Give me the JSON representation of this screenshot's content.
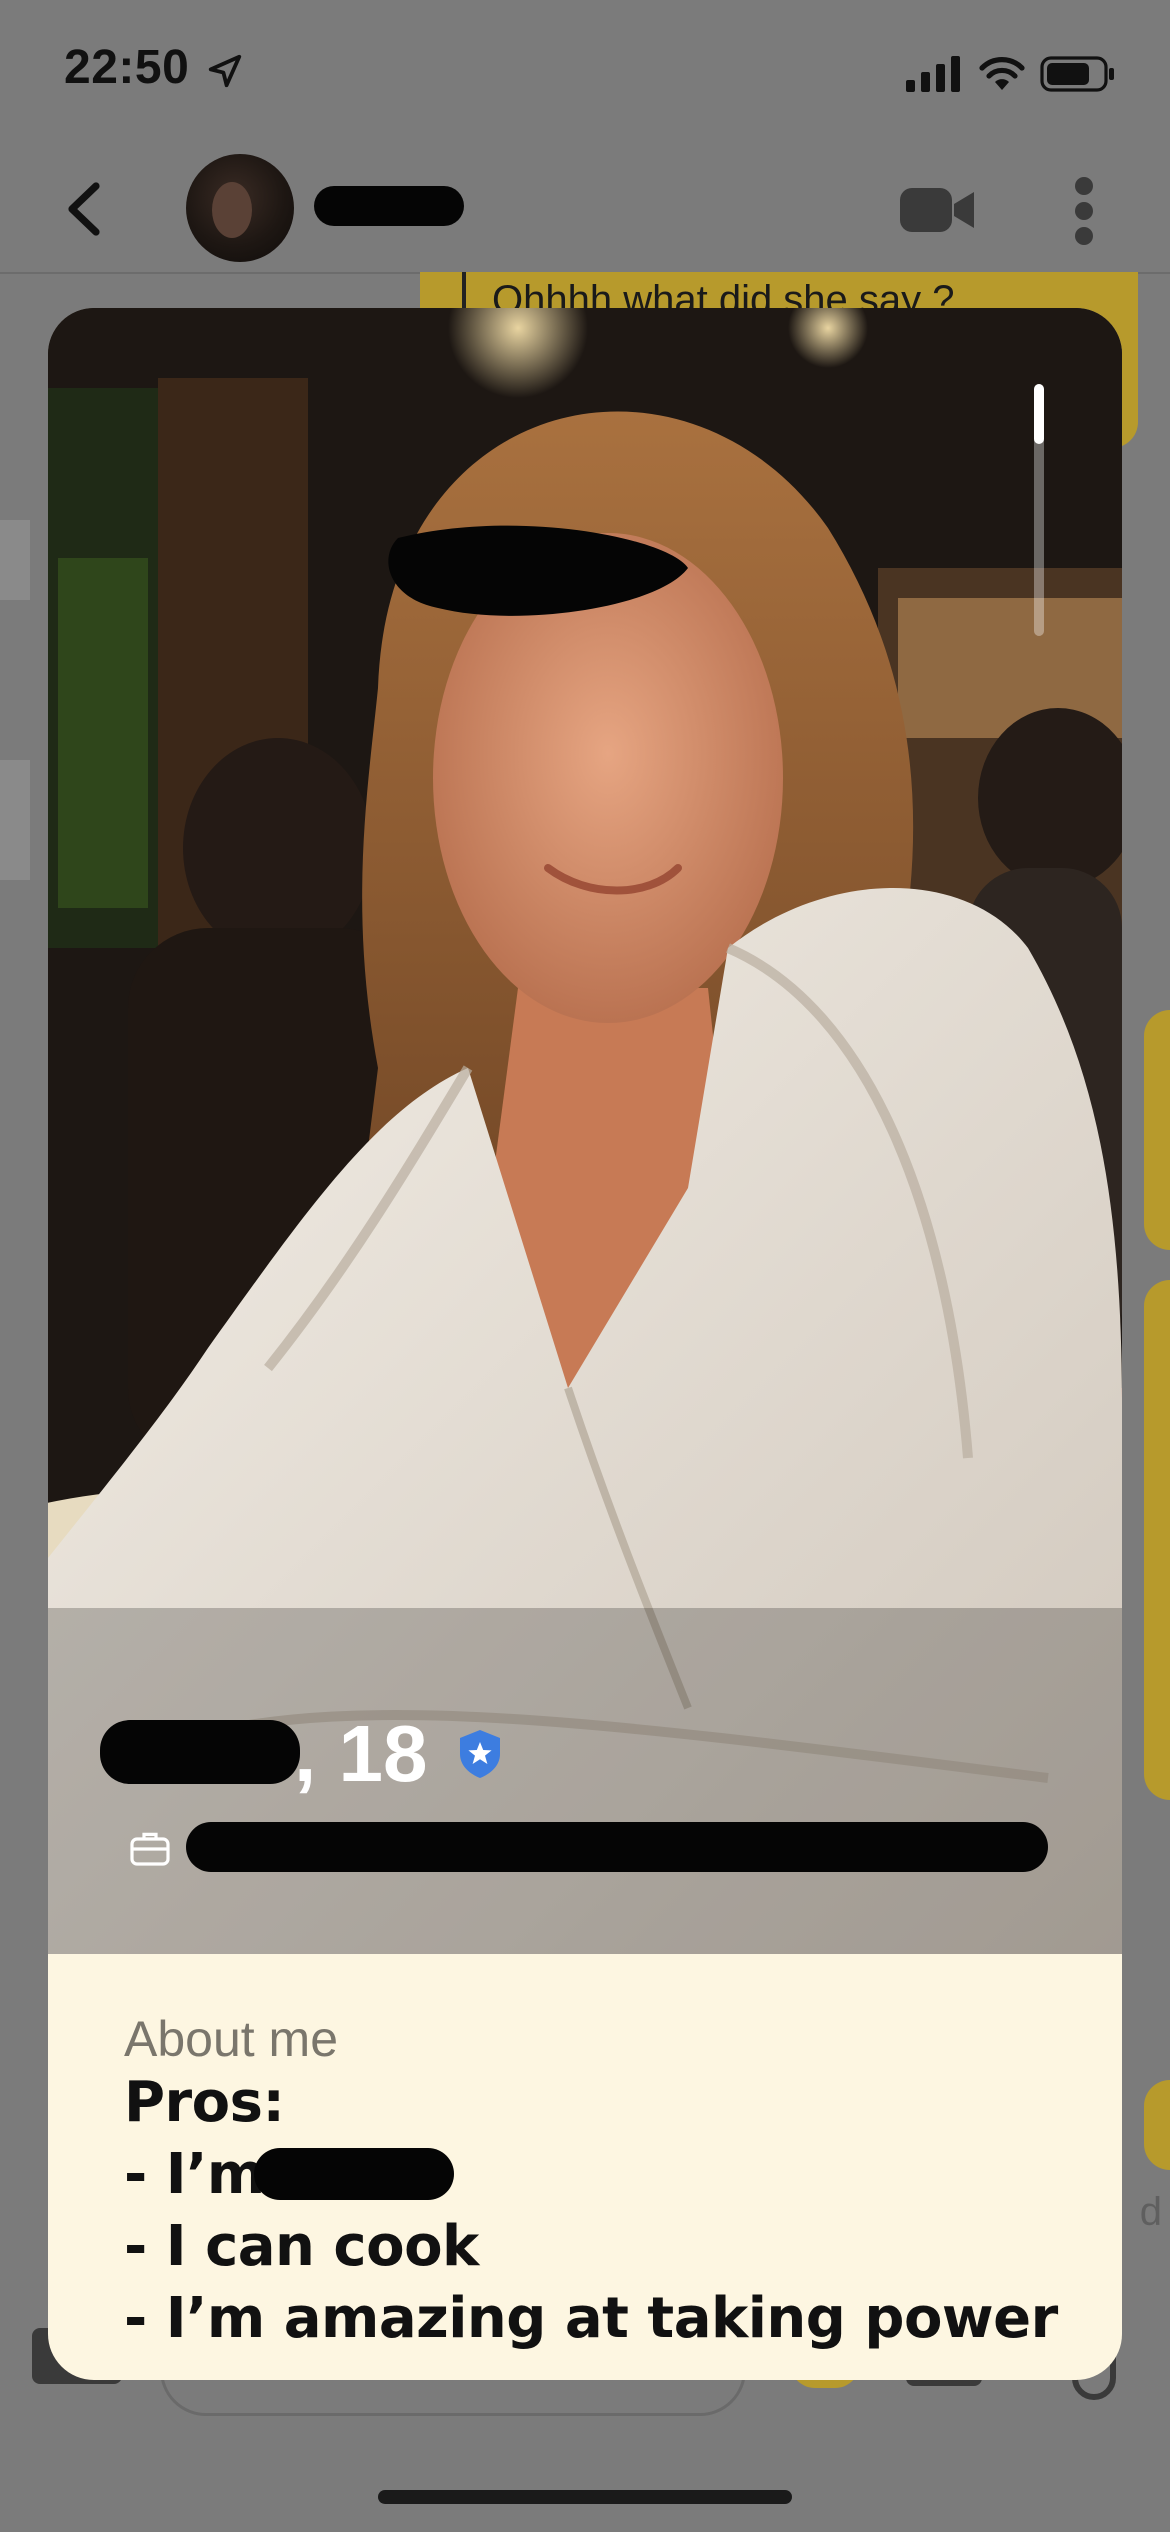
{
  "status_bar": {
    "time": "22:50",
    "icons": [
      "location-arrow-icon",
      "cellular-signal-icon",
      "wifi-icon",
      "battery-icon"
    ]
  },
  "chat_header": {
    "back_icon": "chevron-left-icon",
    "video_icon": "video-camera-icon",
    "more_icon": "vertical-ellipsis-icon"
  },
  "background_chat": {
    "reply_quote": "Ohhhh what did she say ?",
    "side_fragment": "d"
  },
  "profile": {
    "age_text": ", 18",
    "verified_icon": "verified-shield-star-icon",
    "work_icon": "briefcase-icon",
    "about_heading": "About me",
    "bio": {
      "line1": "Pros:",
      "line2": "- I’m",
      "line3": "- I can cook",
      "line4": "- I’m amazing at taking power"
    }
  },
  "colors": {
    "overlay": "#7b7b7b",
    "accent_yellow": "#b79a2c",
    "card_background": "#fdf6e1",
    "verified_blue": "#3d7de0"
  }
}
